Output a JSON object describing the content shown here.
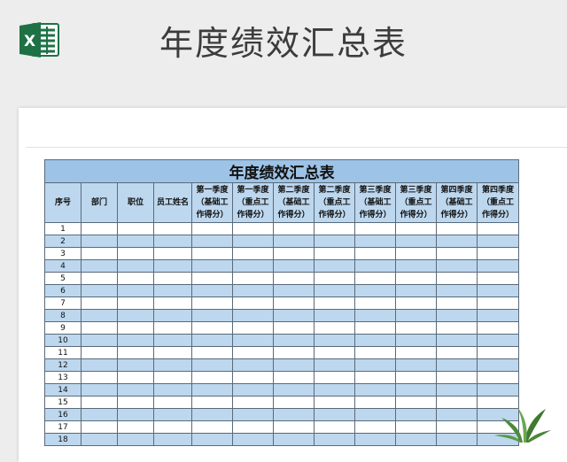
{
  "page": {
    "title": "年度绩效汇总表"
  },
  "logo": {
    "letter": "X",
    "icon": "excel-icon",
    "color": "#1e7145"
  },
  "table": {
    "title": "年度绩效汇总表",
    "headers": [
      "序号",
      "部门",
      "职位",
      "员工姓名",
      "第一季度\n（基础工\n作得分）",
      "第一季度\n（重点工\n作得分）",
      "第二季度\n（基础工\n作得分）",
      "第二季度\n（重点工\n作得分）",
      "第三季度\n（基础工\n作得分）",
      "第三季度\n（重点工\n作得分）",
      "第四季度\n（基础工\n作得分）",
      "第四季度\n（重点工\n作得分）"
    ],
    "rows": [
      "1",
      "2",
      "3",
      "4",
      "5",
      "6",
      "7",
      "8",
      "9",
      "10",
      "11",
      "12",
      "13",
      "14",
      "15",
      "16",
      "17",
      "18"
    ],
    "colors": {
      "title_bg": "#9dc3e6",
      "header_bg": "#bdd7ee",
      "stripe": "#bdd7ee"
    }
  },
  "decor": {
    "plant_icon": "plant-icon"
  }
}
